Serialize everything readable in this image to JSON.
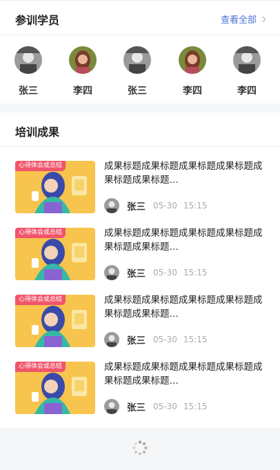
{
  "trainees": {
    "title": "参训学员",
    "view_all": "查看全部",
    "students": [
      {
        "name": "张三",
        "avatar": "male-avatar"
      },
      {
        "name": "李四",
        "avatar": "female-avatar"
      },
      {
        "name": "张三",
        "avatar": "male-avatar"
      },
      {
        "name": "李四",
        "avatar": "female-avatar"
      },
      {
        "name": "李四",
        "avatar": "male-avatar"
      }
    ]
  },
  "results": {
    "title": "培训成果",
    "items": [
      {
        "tag": "心得体会或总结",
        "title": "成果标题成果标题成果标题成果标题成果标题成果标题…",
        "author": "张三",
        "date": "05-30",
        "time": "15:15"
      },
      {
        "tag": "心得体会或总结",
        "title": "成果标题成果标题成果标题成果标题成果标题成果标题…",
        "author": "张三",
        "date": "05-30",
        "time": "15:15"
      },
      {
        "tag": "心得体会或总结",
        "title": "成果标题成果标题成果标题成果标题成果标题成果标题…",
        "author": "张三",
        "date": "05-30",
        "time": "15:15"
      },
      {
        "tag": "心得体会或总结",
        "title": "成果标题成果标题成果标题成果标题成果标题成果标题…",
        "author": "张三",
        "date": "05-30",
        "time": "15:15"
      }
    ]
  },
  "colors": {
    "accent": "#4a72d8",
    "tag_bg": "#f0556a",
    "thumb_bg": "#f7c44d",
    "page_bg": "#f5f6f8"
  }
}
